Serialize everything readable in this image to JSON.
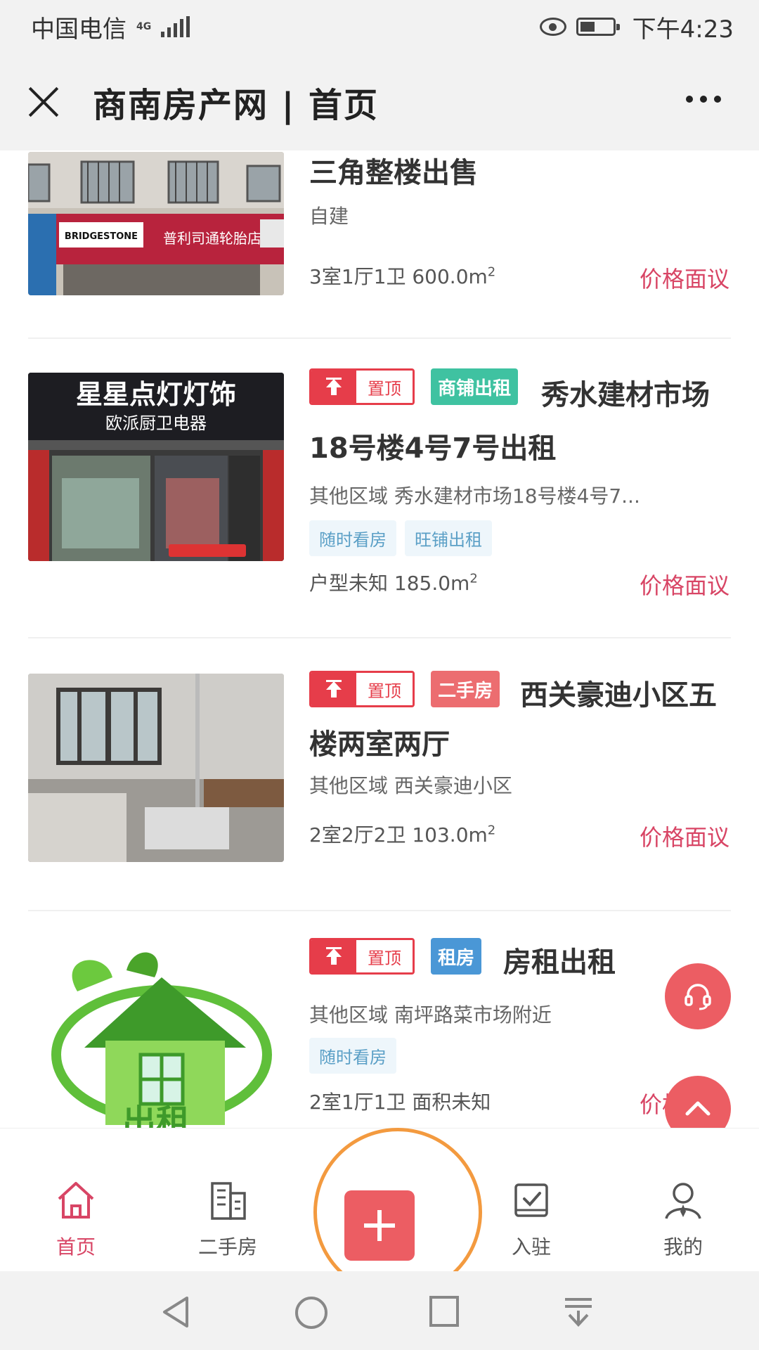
{
  "status_bar": {
    "carrier": "中国电信",
    "network": "4G",
    "time": "下午4:23"
  },
  "nav": {
    "title": "商南房产网 | 首页"
  },
  "listings": [
    {
      "title": "三角整楼出售",
      "district": "自建",
      "specs": "3室1厅1卫  600.0m",
      "area_sup": "2",
      "price": "价格面议",
      "badges": [],
      "tags": []
    },
    {
      "pin_label": "置顶",
      "type_label": "商铺出租",
      "type_color": "#3fc2a1",
      "title": "秀水建材市场18号楼4号7号出租",
      "district": "其他区域 秀水建材市场18号楼4号7...",
      "tags": [
        "随时看房",
        "旺铺出租"
      ],
      "specs": "户型未知  185.0m",
      "area_sup": "2",
      "price": "价格面议"
    },
    {
      "pin_label": "置顶",
      "type_label": "二手房",
      "type_color": "#ec6d70",
      "title": "西关豪迪小区五楼两室两厅",
      "district": "其他区域 西关豪迪小区",
      "tags": [],
      "specs": "2室2厅2卫  103.0m",
      "area_sup": "2",
      "price": "价格面议"
    },
    {
      "pin_label": "置顶",
      "type_label": "租房",
      "type_color": "#4a97d6",
      "title": "房租出租",
      "district": "其他区域 南坪路菜市场附近",
      "tags": [
        "随时看房"
      ],
      "specs": "2室1厅1卫  面积未知",
      "price": "价格面议"
    }
  ],
  "thumb_text": {
    "shop1_brand": "BRIDGESTONE",
    "shop1_sign": "普利司通轮胎店",
    "shop2_sign": "星星点灯灯饰",
    "shop2_sub": "欧派厨卫电器",
    "rent_sign": "出租"
  },
  "tabbar": [
    {
      "label": "首页",
      "icon": "home-icon",
      "active": true
    },
    {
      "label": "二手房",
      "icon": "building-icon"
    },
    {
      "label": "入驻",
      "icon": "checkin-icon"
    },
    {
      "label": "我的",
      "icon": "profile-icon"
    }
  ],
  "colors": {
    "accent": "#d84565",
    "fab": "#ec5d63",
    "annotation": "#f39a3f"
  }
}
